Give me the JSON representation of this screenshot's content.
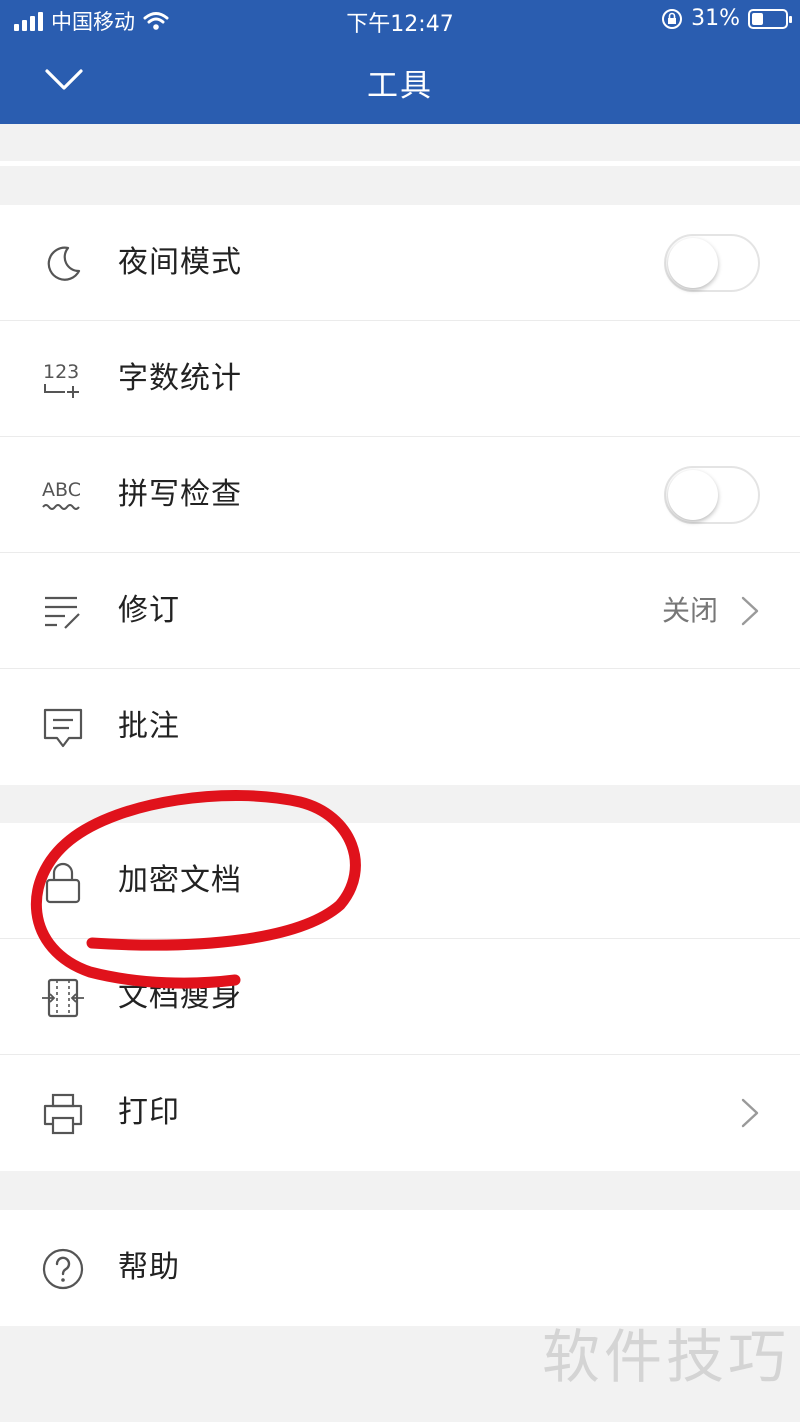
{
  "status_bar": {
    "carrier": "中国移动",
    "time": "下午12:47",
    "battery": "31%"
  },
  "header": {
    "title": "工具"
  },
  "groups": {
    "view": {
      "night_mode": {
        "label": "夜间模式",
        "toggle_on": false
      },
      "word_count": {
        "label": "字数统计"
      },
      "spell_check": {
        "label": "拼写检查",
        "toggle_on": false
      },
      "revision": {
        "label": "修订",
        "value": "关闭"
      },
      "comment": {
        "label": "批注"
      }
    },
    "document": {
      "encrypt": {
        "label": "加密文档"
      },
      "slim": {
        "label": "文档瘦身"
      },
      "print": {
        "label": "打印"
      }
    },
    "help": {
      "label": "帮助"
    }
  },
  "watermark": "软件技巧",
  "colors": {
    "header_bg": "#2a5db0",
    "annotation": "#e0121b"
  }
}
